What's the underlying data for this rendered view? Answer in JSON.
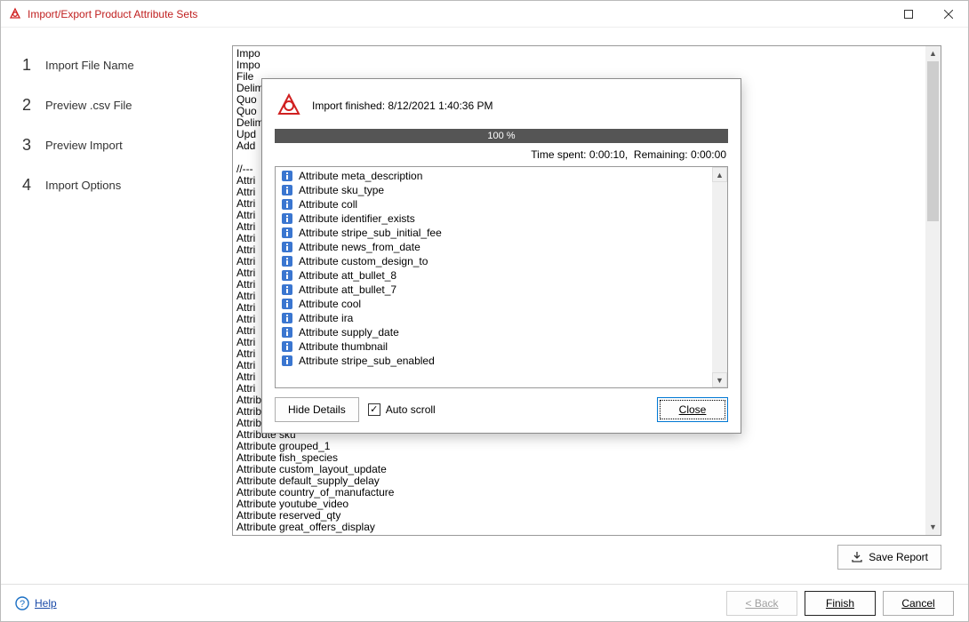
{
  "window": {
    "title": "Import/Export Product Attribute Sets"
  },
  "steps": [
    {
      "num": "1",
      "label": "Import File Name"
    },
    {
      "num": "2",
      "label": "Preview .csv File"
    },
    {
      "num": "3",
      "label": "Preview Import"
    },
    {
      "num": "4",
      "label": "Import Options"
    }
  ],
  "log_lines": [
    "Impo",
    "Impo",
    "File",
    "Delim",
    "Quo",
    "Quo",
    "Delim",
    "Upd",
    "Add",
    "",
    "//---",
    "Attri",
    "Attri",
    "Attri",
    "Attri",
    "Attri",
    "Attri",
    "Attri",
    "Attri",
    "Attri",
    "Attri",
    "Attri",
    "Attri",
    "Attri",
    "Attri",
    "Attri",
    "Attri",
    "Attri",
    "Attri",
    "Attri",
    "Attribute rest",
    "Attribute stripe_sub_trial",
    "Attribute rating",
    "Attribute sku",
    "Attribute grouped_1",
    "Attribute fish_species",
    "Attribute custom_layout_update",
    "Attribute default_supply_delay",
    "Attribute country_of_manufacture",
    "Attribute youtube_video",
    "Attribute reserved_qty",
    "Attribute great_offers_display"
  ],
  "save_report_label": "Save Report",
  "footer": {
    "help": "Help",
    "back": "< Back",
    "finish": "Finish",
    "cancel": "Cancel"
  },
  "modal": {
    "head": "Import finished: 8/12/2021 1:40:36 PM",
    "percent": "100 %",
    "time_spent_label": "Time spent:",
    "time_spent_value": "0:00:10,",
    "remaining_label": "Remaining:",
    "remaining_value": "0:00:00",
    "items": [
      "Attribute meta_description",
      "Attribute sku_type",
      "Attribute coll",
      "Attribute identifier_exists",
      "Attribute stripe_sub_initial_fee",
      "Attribute news_from_date",
      "Attribute custom_design_to",
      "Attribute att_bullet_8",
      "Attribute att_bullet_7",
      "Attribute cool",
      "Attribute ira",
      "Attribute supply_date",
      "Attribute thumbnail",
      "Attribute stripe_sub_enabled"
    ],
    "hide_details": "Hide Details",
    "auto_scroll": "Auto scroll",
    "close": "Close"
  }
}
